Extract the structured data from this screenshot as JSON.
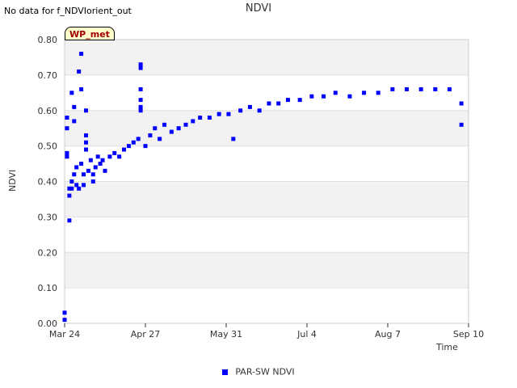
{
  "message": "No data for f_NDVIorient_out",
  "site_tag": "WP_met",
  "chart_data": {
    "type": "scatter",
    "title": "NDVI",
    "xlabel": "Time",
    "ylabel": "NDVI",
    "x_ticks": [
      "Mar 24",
      "Apr 27",
      "May 31",
      "Jul 4",
      "Aug 7",
      "Sep 10"
    ],
    "y_ticks": [
      "0.00",
      "0.10",
      "0.20",
      "0.30",
      "0.40",
      "0.50",
      "0.60",
      "0.70",
      "0.80"
    ],
    "xlim_days_label": [
      "Mar 24",
      "Sep 10"
    ],
    "ylim": [
      0,
      0.8
    ],
    "grid": "horizontal bands",
    "legend_position": "bottom",
    "series": [
      {
        "name": "PAR-SW NDVI",
        "color": "#0000ff",
        "x_unit": "date",
        "points": [
          [
            "03-24",
            0.03
          ],
          [
            "03-24",
            0.01
          ],
          [
            "03-25",
            0.58
          ],
          [
            "03-25",
            0.55
          ],
          [
            "03-25",
            0.48
          ],
          [
            "03-25",
            0.47
          ],
          [
            "03-26",
            0.38
          ],
          [
            "03-26",
            0.36
          ],
          [
            "03-26",
            0.29
          ],
          [
            "03-27",
            0.4
          ],
          [
            "03-27",
            0.38
          ],
          [
            "03-27",
            0.65
          ],
          [
            "03-28",
            0.42
          ],
          [
            "03-28",
            0.61
          ],
          [
            "03-28",
            0.57
          ],
          [
            "03-29",
            0.44
          ],
          [
            "03-29",
            0.39
          ],
          [
            "03-30",
            0.71
          ],
          [
            "03-30",
            0.38
          ],
          [
            "03-31",
            0.76
          ],
          [
            "03-31",
            0.66
          ],
          [
            "03-31",
            0.45
          ],
          [
            "04-01",
            0.39
          ],
          [
            "04-01",
            0.42
          ],
          [
            "04-02",
            0.53
          ],
          [
            "04-02",
            0.51
          ],
          [
            "04-02",
            0.49
          ],
          [
            "04-02",
            0.6
          ],
          [
            "04-03",
            0.43
          ],
          [
            "04-04",
            0.46
          ],
          [
            "04-05",
            0.42
          ],
          [
            "04-05",
            0.4
          ],
          [
            "04-06",
            0.44
          ],
          [
            "04-07",
            0.47
          ],
          [
            "04-08",
            0.45
          ],
          [
            "04-09",
            0.46
          ],
          [
            "04-10",
            0.43
          ],
          [
            "04-12",
            0.47
          ],
          [
            "04-14",
            0.48
          ],
          [
            "04-16",
            0.47
          ],
          [
            "04-18",
            0.49
          ],
          [
            "04-20",
            0.5
          ],
          [
            "04-22",
            0.51
          ],
          [
            "04-24",
            0.52
          ],
          [
            "04-25",
            0.73
          ],
          [
            "04-25",
            0.72
          ],
          [
            "04-25",
            0.66
          ],
          [
            "04-25",
            0.63
          ],
          [
            "04-25",
            0.61
          ],
          [
            "04-25",
            0.6
          ],
          [
            "04-27",
            0.5
          ],
          [
            "04-29",
            0.53
          ],
          [
            "05-01",
            0.55
          ],
          [
            "05-03",
            0.52
          ],
          [
            "05-05",
            0.56
          ],
          [
            "05-08",
            0.54
          ],
          [
            "05-11",
            0.55
          ],
          [
            "05-14",
            0.56
          ],
          [
            "05-17",
            0.57
          ],
          [
            "05-20",
            0.58
          ],
          [
            "05-24",
            0.58
          ],
          [
            "05-28",
            0.59
          ],
          [
            "06-01",
            0.59
          ],
          [
            "06-03",
            0.52
          ],
          [
            "06-06",
            0.6
          ],
          [
            "06-10",
            0.61
          ],
          [
            "06-14",
            0.6
          ],
          [
            "06-18",
            0.62
          ],
          [
            "06-22",
            0.62
          ],
          [
            "06-26",
            0.63
          ],
          [
            "07-01",
            0.63
          ],
          [
            "07-06",
            0.64
          ],
          [
            "07-11",
            0.64
          ],
          [
            "07-16",
            0.65
          ],
          [
            "07-22",
            0.64
          ],
          [
            "07-28",
            0.65
          ],
          [
            "08-03",
            0.65
          ],
          [
            "08-09",
            0.66
          ],
          [
            "08-15",
            0.66
          ],
          [
            "08-21",
            0.66
          ],
          [
            "08-27",
            0.66
          ],
          [
            "09-02",
            0.66
          ],
          [
            "09-07",
            0.62
          ],
          [
            "09-07",
            0.56
          ]
        ]
      }
    ]
  }
}
